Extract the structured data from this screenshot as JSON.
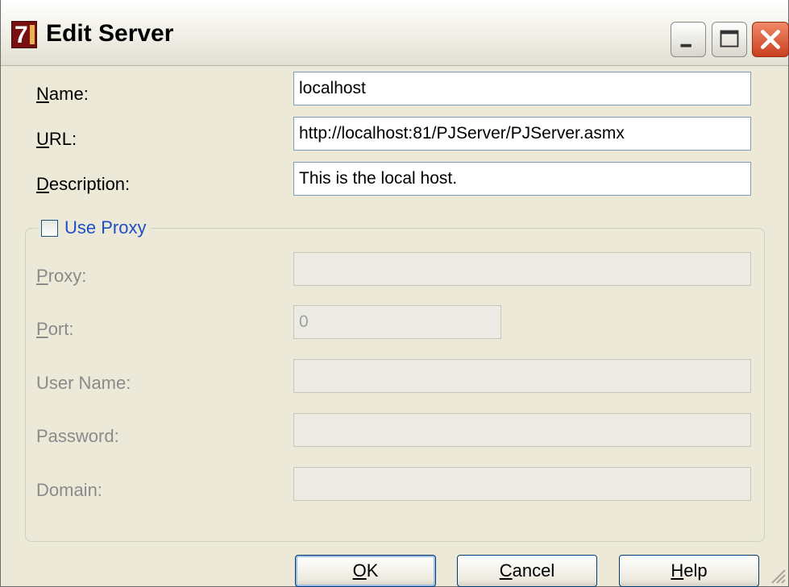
{
  "window": {
    "title": "Edit Server"
  },
  "fields": {
    "name": {
      "label_ul": "N",
      "label_rest": "ame:",
      "value": "localhost"
    },
    "url": {
      "label_ul": "U",
      "label_rest": "RL:",
      "value": "http://localhost:81/PJServer/PJServer.asmx"
    },
    "description": {
      "label_ul": "D",
      "label_rest": "escription:",
      "value": "This is the local host."
    }
  },
  "proxy_group": {
    "checkbox_label": "Use Proxy",
    "checked": false,
    "proxy": {
      "label_ul": "P",
      "label_rest": "roxy:",
      "value": ""
    },
    "port": {
      "label_ul": "P",
      "label_rest": "ort:",
      "value": "0"
    },
    "user_name": {
      "label": "User Name:",
      "value": ""
    },
    "password": {
      "label": "Password:",
      "value": ""
    },
    "domain": {
      "label": "Domain:",
      "value": ""
    }
  },
  "buttons": {
    "ok": {
      "ul": "O",
      "rest": "K"
    },
    "cancel": {
      "ul": "C",
      "rest": "ancel"
    },
    "help": {
      "ul": "H",
      "rest": "elp"
    }
  },
  "colors": {
    "dialog_bg": "#ece9d8",
    "link_blue": "#1f4fc4",
    "disabled_text": "#8a8a8a"
  }
}
